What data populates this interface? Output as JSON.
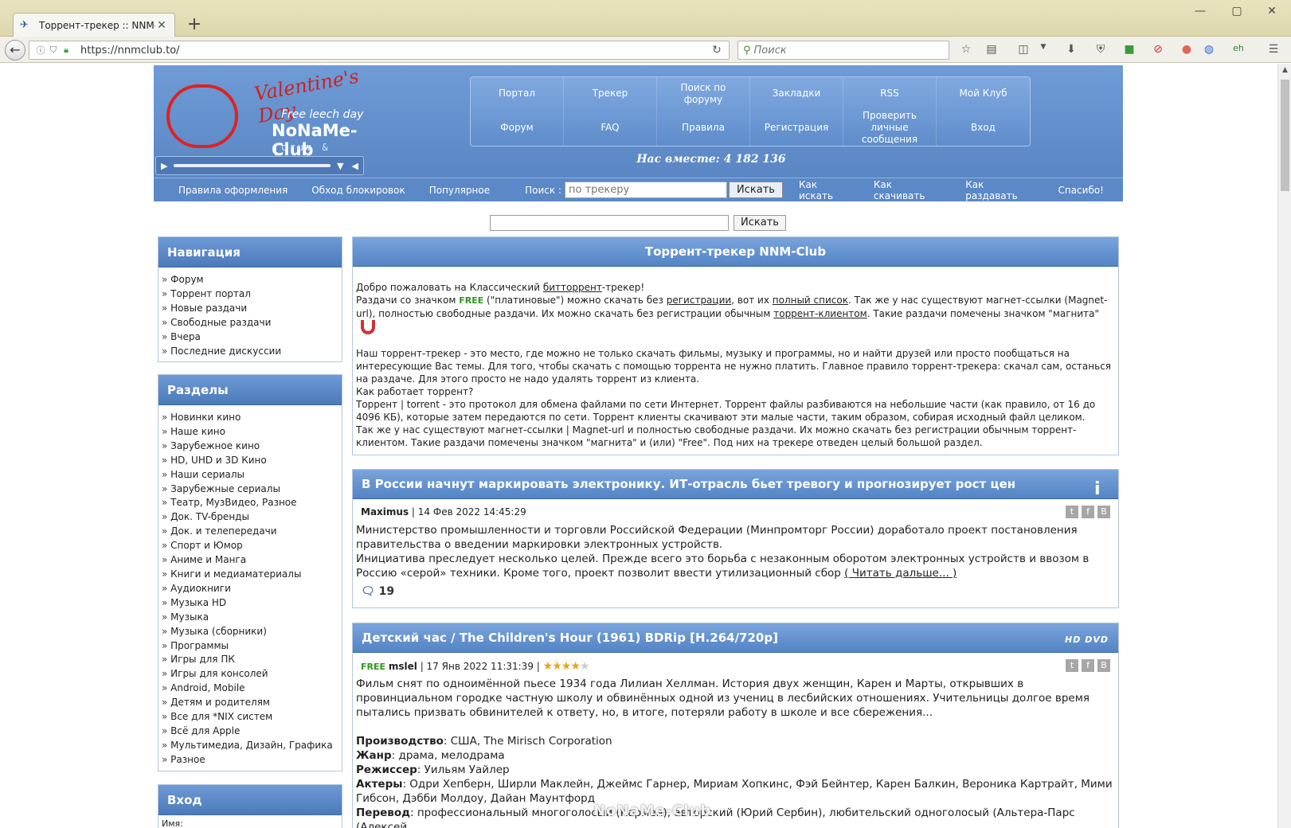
{
  "browser": {
    "tab_title": "Торрент-трекер :: NNM-Club",
    "url": "https://nnmclub.to/",
    "search_placeholder": "Поиск"
  },
  "logo": {
    "valentine": "Valentine's Day",
    "freeleech": "Free leech day",
    "brand": "NoNaMe-Club",
    "tagline": "forum & tracker"
  },
  "topnav": [
    "Портал",
    "Трекер",
    "Поиск по форуму",
    "Закладки",
    "RSS",
    "Мой Клуб",
    "Форум",
    "FAQ",
    "Правила",
    "Регистрация",
    "Проверить личные сообщения",
    "Вход"
  ],
  "together": "Нас вместе: 4 182 136",
  "subnav": {
    "left_links": [
      "Правила оформления",
      "Обход блокировок",
      "Популярное"
    ],
    "search_label": "Поиск :",
    "search_placeholder": "по трекеру",
    "search_button": "Искать",
    "right_links": [
      "Как искать",
      "Как скачивать",
      "Как раздавать",
      "Спасибо!"
    ]
  },
  "global_search": {
    "button": "Искать"
  },
  "sidebar": {
    "navigation": {
      "title": "Навигация",
      "items": [
        "Форум",
        "Торрент портал",
        "Новые раздачи",
        "Свободные раздачи",
        "Вчера",
        "Последние дискуссии"
      ]
    },
    "sections": {
      "title": "Разделы",
      "items": [
        "Новинки кино",
        "Наше кино",
        "Зарубежное кино",
        "HD, UHD и 3D Кино",
        "Наши сериалы",
        "Зарубежные сериалы",
        "Театр, МузВидео, Разное",
        "Док. TV-бренды",
        "Док. и телепередачи",
        "Спорт и Юмор",
        "Аниме и Манга",
        "Книги и медиаматериалы",
        "Аудиокниги",
        "Музыка HD",
        "Музыка",
        "Музыка (сборники)",
        "Программы",
        "Игры для ПК",
        "Игры для консолей",
        "Android, Mobile",
        "Детям и родителям",
        "Все для *NIX систем",
        "Всё для Apple",
        "Мультимедиа, Дизайн, Графика",
        "Разное"
      ]
    },
    "login": {
      "title": "Вход",
      "name_label": "Имя:"
    }
  },
  "welcome": {
    "title": "Торрент-трекер NNM-Club",
    "line1_a": "Добро пожаловать на Классический ",
    "line1_link": "битторрент",
    "line1_b": "-трекер!",
    "line2_a": "Раздачи со значком ",
    "free": "FREE",
    "line2_b": " (\"платиновые\") можно скачать без ",
    "line2_link1": "регистрации",
    "line2_c": ", вот их ",
    "line2_link2": "полный список",
    "line2_d": ". Так же у нас существуют магнет-ссылки (Magnet-url), полностью свободные раздачи. Их можно скачать без регистрации обычным ",
    "line2_link3": "торрент-клиентом",
    "line2_e": ". Такие раздачи помечены значком \"магнита\"",
    "para2": "Наш торрент-трекер - это место, где можно не только скачать фильмы, музыку и программы, но и найти друзей или просто пообщаться на интересующие Вас темы. Для того, чтобы скачать с помощью торрента не нужно платить. Главное правило торрент-трекера: скачал сам, останься на раздаче. Для этого просто не надо удалять торрент из клиента.",
    "para3": "Как работает торрент?",
    "para4": "Торрент | torrent - это протокол для обмена файлами по сети Интернет. Торрент файлы разбиваются на небольшие части (как правило, от 16 до 4096 КБ), которые затем передаются по сети. Торрент клиенты скачивают эти малые части, таким образом, собирая исходный файл целиком.",
    "para5": "Так же у нас существуют магнет-ссылки | Magnet-url и полностью свободные раздачи. Их можно скачать без регистрации обычным торрент-клиентом. Такие раздачи помечены значком \"магнита\" и (или) \"Free\". Под них на трекере отведен целый большой раздел."
  },
  "news": {
    "title": "В России начнут маркировать электронику. ИТ-отрасль бьет тревогу и прогнозирует рост цен",
    "author": "Maximus",
    "date": "14 Фев 2022 14:45:29",
    "body1": "Министерство промышленности и торговли Российской Федерации (Минпромторг России) доработало проект постановления правительства о введении маркировки электронных устройств.",
    "body2": "Инициатива преследует несколько целей. Прежде всего это борьба с незаконным оборотом электронных устройств и ввозом в Россию «серой» техники. Кроме того, проект позволит ввести утилизационный сбор ",
    "read_more": "( Читать дальше... )",
    "comments": "19"
  },
  "release": {
    "title": "Детский час / The Children's Hour (1961) BDRip [H.264/720p]",
    "hd_badge": "HD DVD",
    "free": "FREE",
    "author": "mslel",
    "date": "17 Янв 2022 11:31:39",
    "rating": 4,
    "desc": "Фильм снят по одноимённой пьесе 1934 года Лилиан Хеллман. История двух женщин, Карен и Марты, открывших в провинциальном городке частную школу и обвинённых одной из учениц в лесбийских отношениях. Учительницы долгое время пытались призвать обвинителей к ответу, но, в итоге, потеряли работу в школе и все сбережения...",
    "fields": [
      {
        "label": "Производство",
        "value": ": США, The Mirisch Corporation"
      },
      {
        "label": "Жанр",
        "value": ": драма, мелодрама"
      },
      {
        "label": "Режиссер",
        "value": ": Уильям Уайлер"
      },
      {
        "label": "Актеры",
        "value": ": Одри Хепберн, Ширли Маклейн, Джеймс Гарнер, Мириам Хопкинс, Фэй Бейнтер, Карен Балкин, Вероника Картрайт, Мими Гибсон, Дэбби Молдоу, Дайан Маунтфорд"
      },
      {
        "label": "Перевод",
        "value": ": профессиональный многоголосый (Кармен), авторский (Юрий Сербин), любительский одноголосый (Альтера-Парс (Алексей"
      }
    ]
  },
  "watermark": "NoNaMe-Club"
}
